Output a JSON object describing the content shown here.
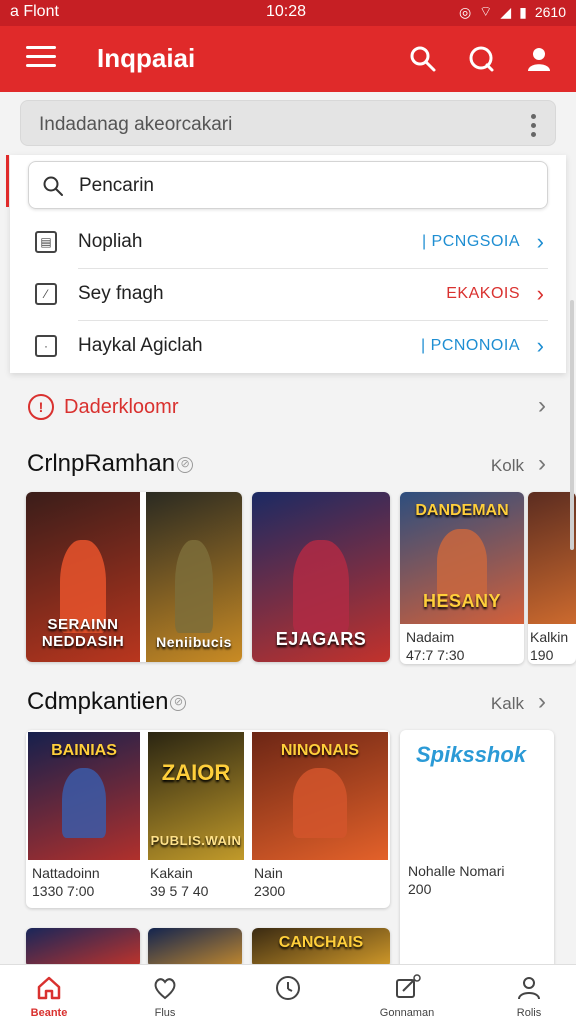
{
  "status_bar": {
    "left": "a Flont",
    "time": "10:28",
    "right": "2610"
  },
  "app_bar": {
    "title": "Inqpaiai"
  },
  "url_bar": {
    "text": "Indadanag akeorcakari"
  },
  "search": {
    "placeholder": "Pencarin"
  },
  "dropdown_rows": [
    {
      "label": "Nopliah",
      "tag": "| PCNGSOIA",
      "tag_color": "#1e8ed2"
    },
    {
      "label": "Sey fnagh",
      "tag": "EKAKOIS",
      "tag_color": "#d9312f"
    },
    {
      "label": "Haykal Agiclah",
      "tag": "| PCNONOIA",
      "tag_color": "#1e8ed2"
    }
  ],
  "link_row": {
    "label": "Daderkloomr"
  },
  "section1": {
    "title": "CrlnpRamhan",
    "more": "Kolk",
    "cards": [
      {
        "caption": "SERAINN NEDDASIH",
        "colors": [
          "#3a1d1a",
          "#b9361e"
        ]
      },
      {
        "caption": "Neniibucis",
        "top": "",
        "colors": [
          "#2a2a22",
          "#c98b24"
        ]
      },
      {
        "caption": "EJAGARS",
        "top": "",
        "colors": [
          "#1b2a63",
          "#c2322c"
        ]
      },
      {
        "caption": "HESANY",
        "top": "DANDEMAN",
        "colors": [
          "#2d4e7e",
          "#d2603a"
        ],
        "meta1": "Nadaim",
        "meta2": "47:7 7:30"
      },
      {
        "caption": "",
        "colors": [
          "#5b2c20",
          "#cc6a2e"
        ],
        "meta1": "Kalkin",
        "meta2": "190"
      }
    ]
  },
  "section2": {
    "title": "Cdmpkantien",
    "more": "Kalk",
    "cards": [
      {
        "caption": "",
        "top": "BAINIAS",
        "colors": [
          "#15204d",
          "#b0302c"
        ],
        "meta1": "Nattadoinn",
        "meta2": "1330 7:00"
      },
      {
        "caption": "PUBLIS.WAIN",
        "top": "ZAIOR",
        "colors": [
          "#2a2512",
          "#c19a2a"
        ],
        "meta1": "Kakain",
        "meta2": "39 5 7 40"
      },
      {
        "caption": "",
        "top": "NINONAIS",
        "colors": [
          "#6c2615",
          "#e3612a"
        ],
        "meta1": "Nain",
        "meta2": "2300"
      },
      {
        "caption": "",
        "top": "",
        "colors": [
          "#ffffff",
          "#ffffff"
        ],
        "logo": "Spiksshok",
        "meta1": "Nohalle Nomari",
        "meta2": "200"
      }
    ]
  },
  "section3": {
    "cards": [
      {
        "colors": [
          "#19265a",
          "#c3342a"
        ]
      },
      {
        "colors": [
          "#13244f",
          "#c48a2e"
        ]
      },
      {
        "top": "CANCHAIS",
        "colors": [
          "#3a2a12",
          "#d39b2a"
        ]
      }
    ]
  },
  "bottom_nav": [
    {
      "label": "Beante",
      "icon": "home-icon",
      "active": true
    },
    {
      "label": "Flus",
      "icon": "heart-icon",
      "active": false
    },
    {
      "label": "",
      "icon": "clock-icon",
      "active": false
    },
    {
      "label": "Gonnaman",
      "icon": "edit-icon",
      "active": false
    },
    {
      "label": "Rolis",
      "icon": "profile-icon",
      "active": false
    }
  ],
  "colors": {
    "primary": "#e02a2a",
    "status_bar": "#c61f24",
    "link_red": "#d9312f",
    "link_blue": "#1e8ed2"
  }
}
